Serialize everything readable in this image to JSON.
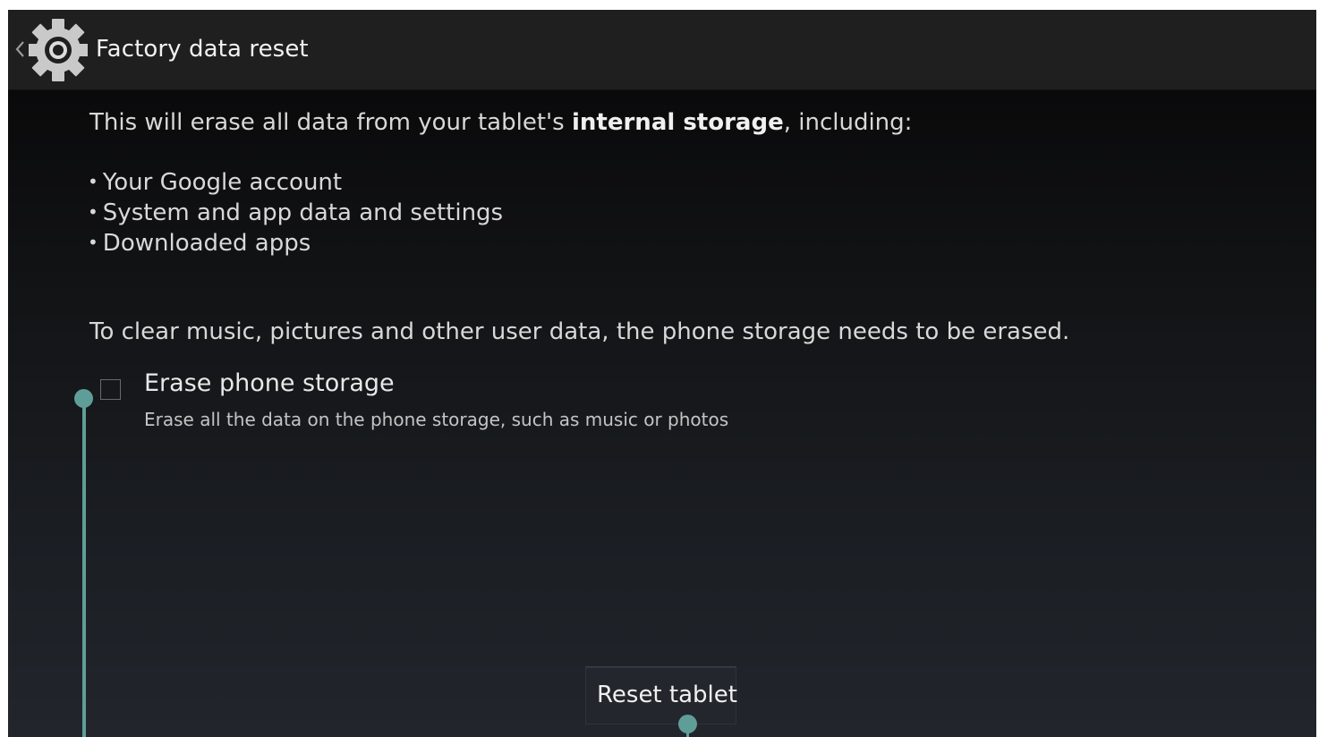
{
  "action_bar": {
    "title": "Factory data reset",
    "back_icon": "chevron-left-icon",
    "app_icon": "settings-gear-icon"
  },
  "content": {
    "intro_prefix": "This will erase all data from your tablet's ",
    "intro_bold": "internal storage",
    "intro_suffix": ", including:",
    "bullets": [
      "Your Google account",
      "System and app data and settings",
      "Downloaded apps"
    ],
    "clear_note": "To clear music, pictures and other user data, the phone storage needs to be erased.",
    "erase_option": {
      "title": "Erase phone storage",
      "summary": "Erase all the data on the phone storage, such as music or photos",
      "checked": false
    },
    "reset_button": "Reset tablet"
  },
  "colors": {
    "accent_handle": "#5f9e98",
    "action_bar": "#1f1f1f"
  }
}
